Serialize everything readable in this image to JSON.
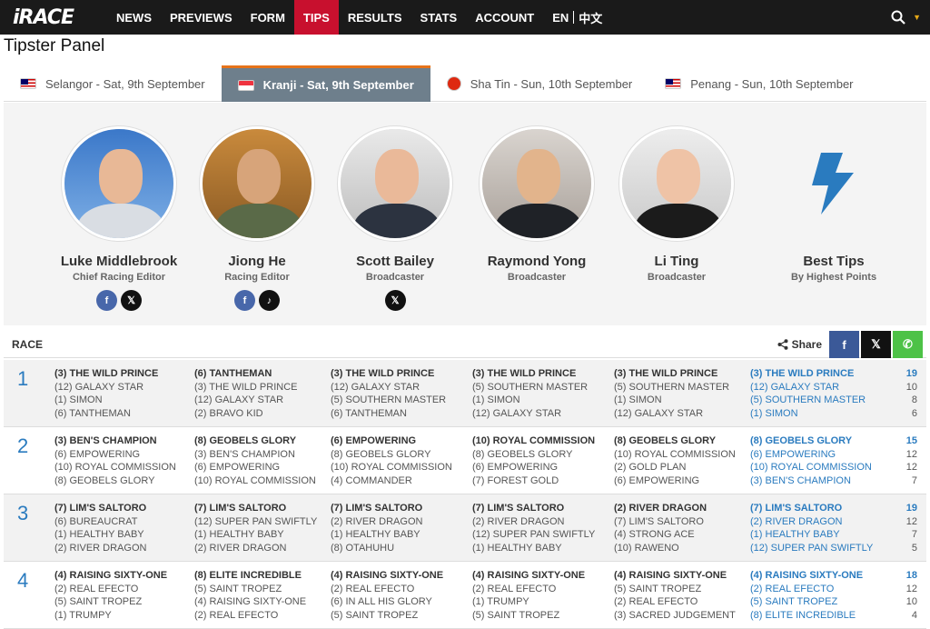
{
  "nav": {
    "logo": "iRACE",
    "items": [
      "NEWS",
      "PREVIEWS",
      "FORM",
      "TIPS",
      "RESULTS",
      "STATS",
      "ACCOUNT"
    ],
    "active": "TIPS",
    "lang_en": "EN",
    "lang_zh": "中文",
    "search_icon": "search-icon",
    "accent": "#c8102e"
  },
  "page_title": "Tipster Panel",
  "tabs": [
    {
      "label": "Selangor - Sat, 9th September",
      "flag": "my"
    },
    {
      "label": "Kranji - Sat, 9th September",
      "flag": "sg",
      "active": true
    },
    {
      "label": "Sha Tin - Sun, 10th September",
      "flag": "hk"
    },
    {
      "label": "Penang - Sun, 10th September",
      "flag": "my"
    }
  ],
  "tipsters": [
    {
      "name": "Luke Middlebrook",
      "role": "Chief Racing Editor",
      "socials": [
        "f",
        "𝕏"
      ]
    },
    {
      "name": "Jiong He",
      "role": "Racing Editor",
      "socials": [
        "f",
        "♪"
      ]
    },
    {
      "name": "Scott Bailey",
      "role": "Broadcaster",
      "socials": [
        "𝕏"
      ]
    },
    {
      "name": "Raymond Yong",
      "role": "Broadcaster",
      "socials": []
    },
    {
      "name": "Li Ting",
      "role": "Broadcaster",
      "socials": []
    }
  ],
  "best_tips": {
    "title": "Best Tips",
    "subtitle": "By Highest Points",
    "icon": "lightning-icon",
    "color": "#2a7bbf"
  },
  "race_header": "RACE",
  "share_label": "Share",
  "share_icons": {
    "fb": "f",
    "x": "𝕏",
    "wa": "✆"
  },
  "races": [
    {
      "no": "1",
      "picks": [
        [
          "(3) THE WILD PRINCE",
          "(12) GALAXY STAR",
          "(1) SIMON",
          "(6) TANTHEMAN"
        ],
        [
          "(6) TANTHEMAN",
          "(3) THE WILD PRINCE",
          "(12) GALAXY STAR",
          "(2) BRAVO KID"
        ],
        [
          "(3) THE WILD PRINCE",
          "(12) GALAXY STAR",
          "(5) SOUTHERN MASTER",
          "(6) TANTHEMAN"
        ],
        [
          "(3) THE WILD PRINCE",
          "(5) SOUTHERN MASTER",
          "(1) SIMON",
          "(12) GALAXY STAR"
        ],
        [
          "(3) THE WILD PRINCE",
          "(5) SOUTHERN MASTER",
          "(1) SIMON",
          "(12) GALAXY STAR"
        ]
      ],
      "best": [
        "(3) THE WILD PRINCE",
        "(12) GALAXY STAR",
        "(5) SOUTHERN MASTER",
        "(1) SIMON"
      ],
      "points": [
        "19",
        "10",
        "8",
        "6"
      ]
    },
    {
      "no": "2",
      "picks": [
        [
          "(3) BEN'S CHAMPION",
          "(6) EMPOWERING",
          "(10) ROYAL COMMISSION",
          "(8) GEOBELS GLORY"
        ],
        [
          "(8) GEOBELS GLORY",
          "(3) BEN'S CHAMPION",
          "(6) EMPOWERING",
          "(10) ROYAL COMMISSION"
        ],
        [
          "(6) EMPOWERING",
          "(8) GEOBELS GLORY",
          "(10) ROYAL COMMISSION",
          "(4) COMMANDER"
        ],
        [
          "(10) ROYAL COMMISSION",
          "(8) GEOBELS GLORY",
          "(6) EMPOWERING",
          "(7) FOREST GOLD"
        ],
        [
          "(8) GEOBELS GLORY",
          "(10) ROYAL COMMISSION",
          "(2) GOLD PLAN",
          "(6) EMPOWERING"
        ]
      ],
      "best": [
        "(8) GEOBELS GLORY",
        "(6) EMPOWERING",
        "(10) ROYAL COMMISSION",
        "(3) BEN'S CHAMPION"
      ],
      "points": [
        "15",
        "12",
        "12",
        "7"
      ]
    },
    {
      "no": "3",
      "picks": [
        [
          "(7) LIM'S SALTORO",
          "(6) BUREAUCRAT",
          "(1) HEALTHY BABY",
          "(2) RIVER DRAGON"
        ],
        [
          "(7) LIM'S SALTORO",
          "(12) SUPER PAN SWIFTLY",
          "(1) HEALTHY BABY",
          "(2) RIVER DRAGON"
        ],
        [
          "(7) LIM'S SALTORO",
          "(2) RIVER DRAGON",
          "(1) HEALTHY BABY",
          "(8) OTAHUHU"
        ],
        [
          "(7) LIM'S SALTORO",
          "(2) RIVER DRAGON",
          "(12) SUPER PAN SWIFTLY",
          "(1) HEALTHY BABY"
        ],
        [
          "(2) RIVER DRAGON",
          "(7) LIM'S SALTORO",
          "(4) STRONG ACE",
          "(10) RAWENO"
        ]
      ],
      "best": [
        "(7) LIM'S SALTORO",
        "(2) RIVER DRAGON",
        "(1) HEALTHY BABY",
        "(12) SUPER PAN SWIFTLY"
      ],
      "points": [
        "19",
        "12",
        "7",
        "5"
      ]
    },
    {
      "no": "4",
      "picks": [
        [
          "(4) RAISING SIXTY-ONE",
          "(2) REAL EFECTO",
          "(5) SAINT TROPEZ",
          "(1) TRUMPY"
        ],
        [
          "(8) ELITE INCREDIBLE",
          "(5) SAINT TROPEZ",
          "(4) RAISING SIXTY-ONE",
          "(2) REAL EFECTO"
        ],
        [
          "(4) RAISING SIXTY-ONE",
          "(2) REAL EFECTO",
          "(6) IN ALL HIS GLORY",
          "(5) SAINT TROPEZ"
        ],
        [
          "(4) RAISING SIXTY-ONE",
          "(2) REAL EFECTO",
          "(1) TRUMPY",
          "(5) SAINT TROPEZ"
        ],
        [
          "(4) RAISING SIXTY-ONE",
          "(5) SAINT TROPEZ",
          "(2) REAL EFECTO",
          "(3) SACRED JUDGEMENT"
        ]
      ],
      "best": [
        "(4) RAISING SIXTY-ONE",
        "(2) REAL EFECTO",
        "(5) SAINT TROPEZ",
        "(8) ELITE INCREDIBLE"
      ],
      "points": [
        "18",
        "12",
        "10",
        "4"
      ]
    }
  ]
}
